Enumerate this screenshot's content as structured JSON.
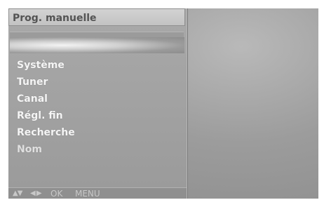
{
  "menu": {
    "title": "Prog. manuelle",
    "items": [
      {
        "label": "Système"
      },
      {
        "label": "Tuner"
      },
      {
        "label": "Canal"
      },
      {
        "label": "Régl. fin"
      },
      {
        "label": "Recherche"
      },
      {
        "label": "Nom"
      }
    ]
  },
  "footer": {
    "updown_icon": "▲▼",
    "leftright_icon": "◀ ▶",
    "ok_label": "OK",
    "menu_label": "MENU"
  },
  "colors": {
    "panel": "#a5a5a5",
    "title_bar": "#c8c8c8",
    "text": "#f5f5f5"
  }
}
